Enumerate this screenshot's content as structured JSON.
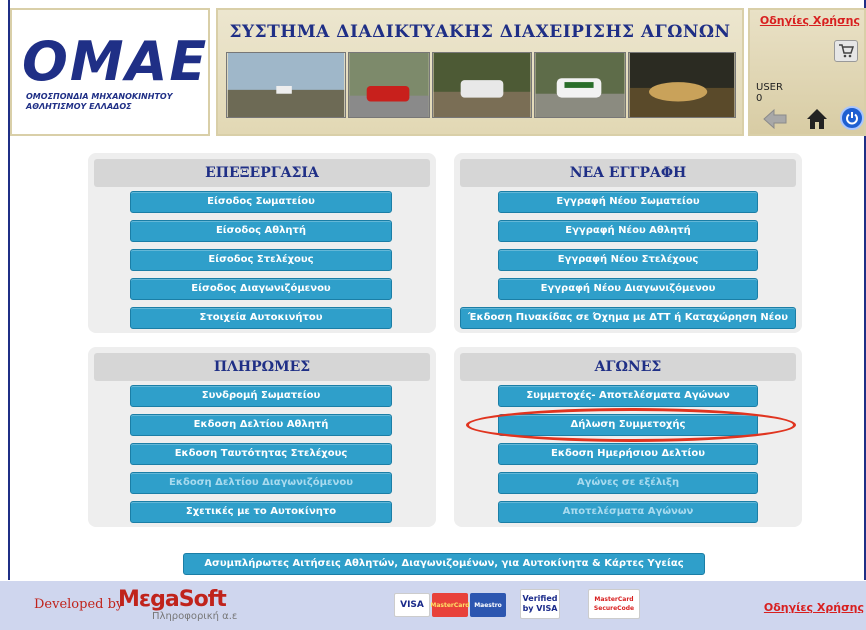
{
  "header": {
    "logo_text": "OMAE",
    "logo_subtitle": "ΟΜΟΣΠΟΝΔΙΑ ΜΗΧΑΝΟΚΙΝΗΤΟΥ ΑΘΛΗΤΙΣΜΟΥ ΕΛΛΑΔΟΣ",
    "banner_title": "ΣΥΣΤΗΜΑ ΔΙΑΔΙΚΤΥΑΚΗΣ ΔΙΑΧΕΙΡΙΣΗΣ ΑΓΩΝΩΝ",
    "help_link": "Οδηγίες Χρήσης",
    "user_label": "USER",
    "user_value": "0"
  },
  "panels": {
    "processing": {
      "title": "ΕΠΕΞΕΡΓΑΣΙΑ",
      "buttons": [
        "Είσοδος Σωματείου",
        "Είσοδος Αθλητή",
        "Είσοδος Στελέχους",
        "Είσοδος Διαγωνιζόμενου",
        "Στοιχεία Αυτοκινήτου"
      ]
    },
    "new_registration": {
      "title": "ΝΕΑ ΕΓΓΡΑΦΗ",
      "buttons": [
        "Εγγραφή Νέου Σωματείου",
        "Εγγραφή Νέου Αθλητή",
        "Εγγραφή Νέου Στελέχους",
        "Εγγραφή Νέου Διαγωνιζόμενου",
        "Έκδοση Πινακίδας σε Όχημα με ΔΤΤ ή Καταχώρηση Νέου"
      ]
    },
    "payments": {
      "title": "ΠΛΗΡΩΜΕΣ",
      "buttons": [
        "Συνδρομή Σωματείου",
        "Εκδοση Δελτίου Αθλητή",
        "Εκδοση Ταυτότητας Στελέχους",
        "Εκδοση Δελτίου Διαγωνιζόμενου",
        "Σχετικές με το Αυτοκίνητο"
      ]
    },
    "races": {
      "title": "ΑΓΩΝΕΣ",
      "buttons": [
        "Συμμετοχές- Αποτελέσματα Αγώνων",
        "Δήλωση Συμμετοχής",
        "Εκδοση Ημερήσιου Δελτίου",
        "Αγώνες σε εξέλιξη",
        "Αποτελέσματα Αγώνων"
      ]
    }
  },
  "bottom_button": "Ασυμπλήρωτες Αιτήσεις Αθλητών, Διαγωνιζομένων, για Αυτοκίνητα & Κάρτες Υγείας",
  "footer": {
    "developed_by": "Developed by",
    "megasoft_word": "MεgaSoft",
    "megasoft_sub": "Πληροφορική α.ε",
    "card_visa": "VISA",
    "card_mastercard": "MasterCard",
    "card_maestro": "Maestro",
    "verified_by_visa": "Verified by VISA",
    "securecode": "MasterCard SecureCode",
    "help_link": "Οδηγίες Χρήσης"
  },
  "colors": {
    "brand_blue": "#1f2f86",
    "button_blue": "#2f9fca",
    "highlight_red": "#e0341f"
  }
}
